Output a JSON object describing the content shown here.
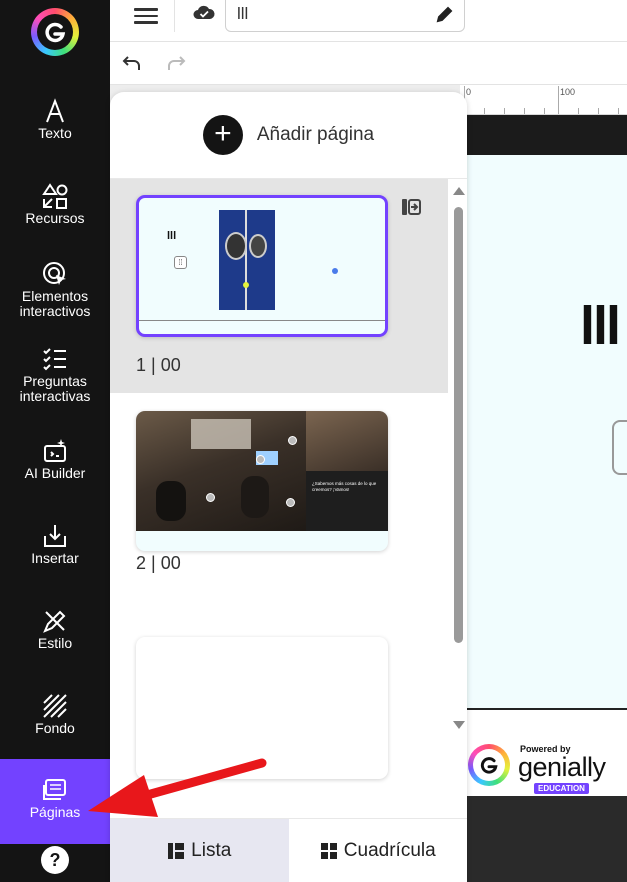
{
  "topbar": {
    "title_value": "lll"
  },
  "sidebar": {
    "items": [
      {
        "label_lines": [
          "Texto"
        ]
      },
      {
        "label_lines": [
          "Recursos"
        ]
      },
      {
        "label_lines": [
          "Elementos",
          "interactivos"
        ]
      },
      {
        "label_lines": [
          "Preguntas",
          "interactivas"
        ]
      },
      {
        "label_lines": [
          "AI Builder"
        ]
      },
      {
        "label_lines": [
          "Insertar"
        ]
      },
      {
        "label_lines": [
          "Estilo"
        ]
      },
      {
        "label_lines": [
          "Fondo"
        ]
      },
      {
        "label_lines": [
          "Páginas"
        ],
        "active": true
      }
    ],
    "help_label": "?"
  },
  "ruler": {
    "labels": [
      "0",
      "100"
    ]
  },
  "slide": {
    "title": "lll",
    "footer": {
      "powered": "Powered by",
      "brand": "genially",
      "badge": "EDUCATION"
    }
  },
  "panel": {
    "add_page_label": "Añadir página",
    "pages": [
      {
        "label": "1 | 00",
        "thumb_text": "lll",
        "selected": true
      },
      {
        "label": "2 | 00",
        "thumb_text": "¿Sabemos más cosas de lo que creemos? ¡Vamos!"
      },
      {
        "label": ""
      }
    ],
    "view_tabs": [
      {
        "label": "Lista",
        "active": true
      },
      {
        "label": "Cuadrícula"
      }
    ]
  },
  "colors": {
    "accent": "#7342ff",
    "sidebar_bg": "#141414",
    "arrow": "#e8171b"
  }
}
